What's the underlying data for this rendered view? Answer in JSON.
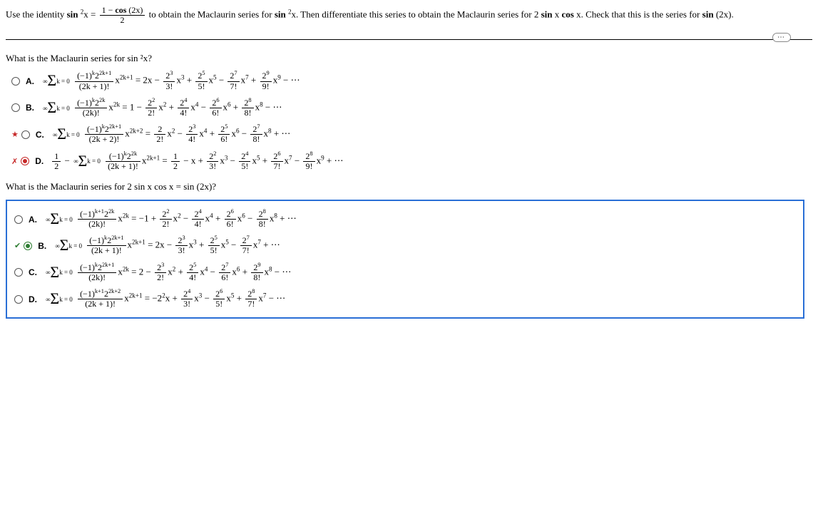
{
  "problem": "Use the identity sin ²x = (1 − cos (2x)) / 2 to obtain the Maclaurin series for sin ²x. Then differentiate this series to obtain the Maclaurin series for 2 sin x cos x. Check that this is the series for sin (2x).",
  "q1": "What is the Maclaurin series for sin ²x?",
  "q2": "What is the Maclaurin series for 2 sin x cos x = sin (2x)?",
  "labels": {
    "A": "A.",
    "B": "B.",
    "C": "C.",
    "D": "D."
  },
  "sum_top": "∞",
  "sum_bottom": "k = 0",
  "q1_opts": {
    "A": {
      "sigma_num": "(−1)ᵏ2²ᵏ⁺¹",
      "sigma_den": "(2k + 1)!",
      "sigma_xpow": "x²ᵏ⁺¹",
      "expansion": " = 2x − (2³/3!)x³ + (2⁵/5!)x⁵ − (2⁷/7!)x⁷ + (2⁹/9!)x⁹ − ⋯"
    },
    "B": {
      "sigma_num": "(−1)ᵏ2²ᵏ",
      "sigma_den": "(2k)!",
      "sigma_xpow": "x²ᵏ",
      "expansion": " = 1 − (2²/2!)x² + (2⁴/4!)x⁴ − (2⁶/6!)x⁶ + (2⁸/8!)x⁸ − ⋯"
    },
    "C": {
      "sigma_num": "(−1)ᵏ2²ᵏ⁺¹",
      "sigma_den": "(2k + 2)!",
      "sigma_xpow": "x²ᵏ⁺²",
      "expansion": " = (2/2!)x² − (2³/4!)x⁴ + (2⁵/6!)x⁶ − (2⁷/8!)x⁸ + ⋯"
    },
    "D": {
      "prefix": "½ − ",
      "sigma_num": "(−1)ᵏ2²ᵏ",
      "sigma_den": "(2k + 1)!",
      "sigma_xpow": "x²ᵏ⁺¹",
      "expansion": " = ½ − x + (2²/3!)x³ − (2⁴/5!)x⁵ + (2⁶/7!)x⁷ − (2⁸/9!)x⁹ + ⋯"
    }
  },
  "q2_opts": {
    "A": {
      "sigma_num": "(−1)ᵏ⁺¹2²ᵏ",
      "sigma_den": "(2k)!",
      "sigma_xpow": "x²ᵏ",
      "expansion": " = −1 + (2²/2!)x² − (2⁴/4!)x⁴ + (2⁶/6!)x⁶ − (2⁸/8!)x⁸ + ⋯"
    },
    "B": {
      "sigma_num": "(−1)ᵏ2²ᵏ⁺¹",
      "sigma_den": "(2k + 1)!",
      "sigma_xpow": "x²ᵏ⁺¹",
      "expansion": " = 2x − (2³/3!)x³ + (2⁵/5!)x⁵ − (2⁷/7!)x⁷ + ⋯"
    },
    "C": {
      "sigma_num": "(−1)ᵏ2²ᵏ⁺¹",
      "sigma_den": "(2k)!",
      "sigma_xpow": "x²ᵏ",
      "expansion": " = 2 − (2³/2!)x² + (2⁵/4!)x⁴ − (2⁷/6!)x⁶ + (2⁹/8!)x⁸ − ⋯"
    },
    "D": {
      "sigma_num": "(−1)ᵏ⁺¹2²ᵏ⁺²",
      "sigma_den": "(2k + 1)!",
      "sigma_xpow": "x²ᵏ⁺¹",
      "expansion": " = −2²x + (2⁴/3!)x³ − (2⁶/5!)x⁵ + (2⁸/7!)x⁷ − ⋯"
    }
  }
}
